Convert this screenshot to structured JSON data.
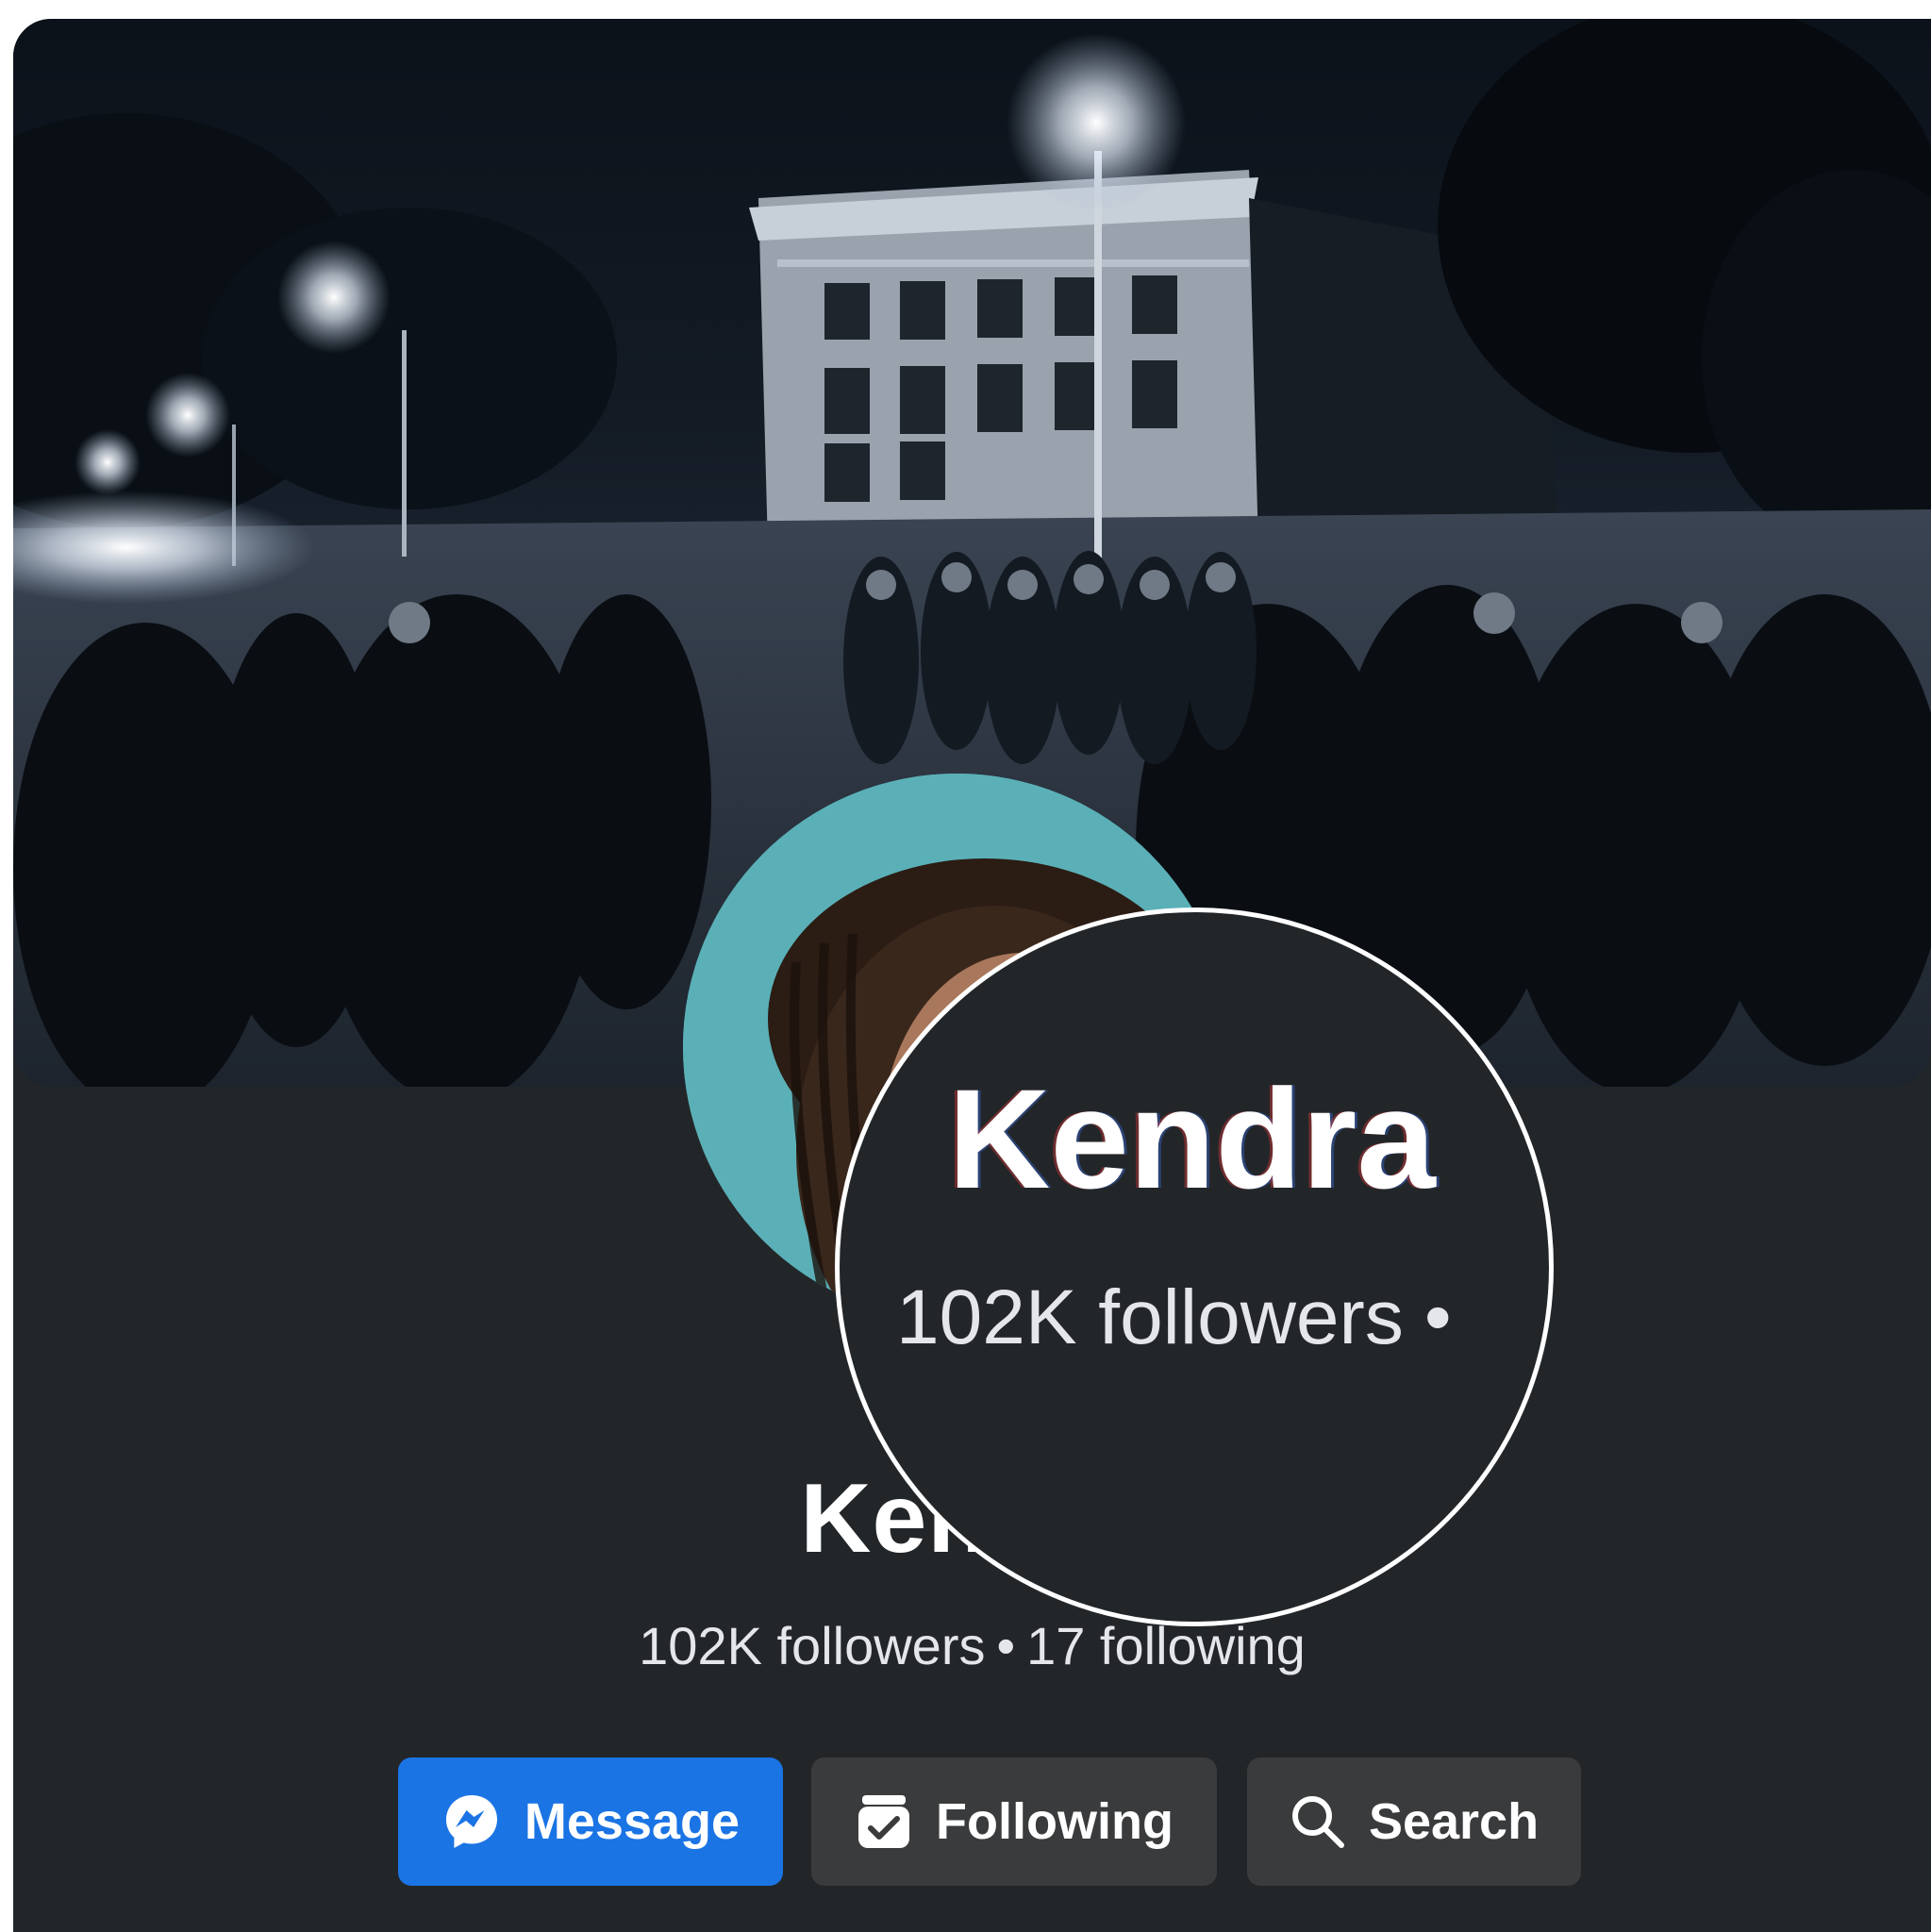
{
  "profile": {
    "name": "Kendra",
    "followers": "102K followers",
    "separator": "•",
    "following": "17 following"
  },
  "magnifier": {
    "name": "Kendra",
    "followers": "102K followers",
    "separator": "•"
  },
  "actions": {
    "message_label": "Message",
    "following_label": "Following",
    "search_label": "Search"
  },
  "icons": {
    "message": "messenger-icon",
    "following": "following-check-icon",
    "search": "search-icon"
  },
  "colors": {
    "background": "#232629",
    "primary_button": "#1b74e4",
    "secondary_button": "#3a3b3c",
    "text": "#ffffff"
  }
}
